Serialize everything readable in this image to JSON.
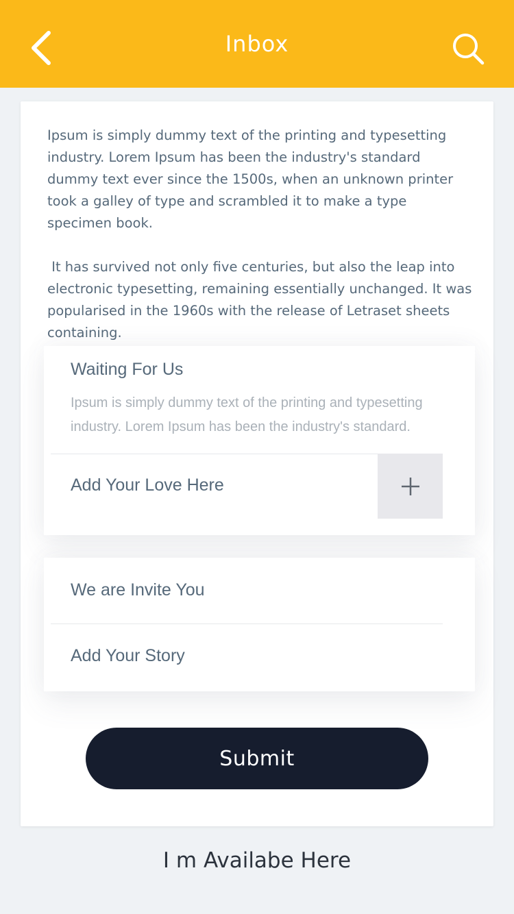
{
  "header": {
    "title": "Inbox",
    "back_icon": "chevron-left-icon",
    "search_icon": "search-icon",
    "background_color": "#fbb919"
  },
  "intro": {
    "paragraph_1": "Ipsum is simply dummy text of the printing and typesetting industry. Lorem Ipsum has been the industry's standard dummy text ever since the 1500s, when an unknown printer took a galley of type and scrambled it to make a type specimen book.",
    "paragraph_2": " It has survived not only five centuries, but also the leap into electronic typesetting, remaining essentially unchanged. It was popularised in the 1960s with the release of Letraset sheets containing."
  },
  "waiting_panel": {
    "heading": "Waiting For Us",
    "description": "Ipsum is simply dummy text of the printing and typesetting industry. Lorem Ipsum has been the industry's standard.",
    "add_label": "Add Your Love Here",
    "add_icon": "plus-icon"
  },
  "invite_panel": {
    "heading": "We are Invite You",
    "story_label": "Add Your Story"
  },
  "submit": {
    "label": "Submit",
    "color": "#161d2e"
  },
  "footer": {
    "text": "I m Availabe Here"
  }
}
